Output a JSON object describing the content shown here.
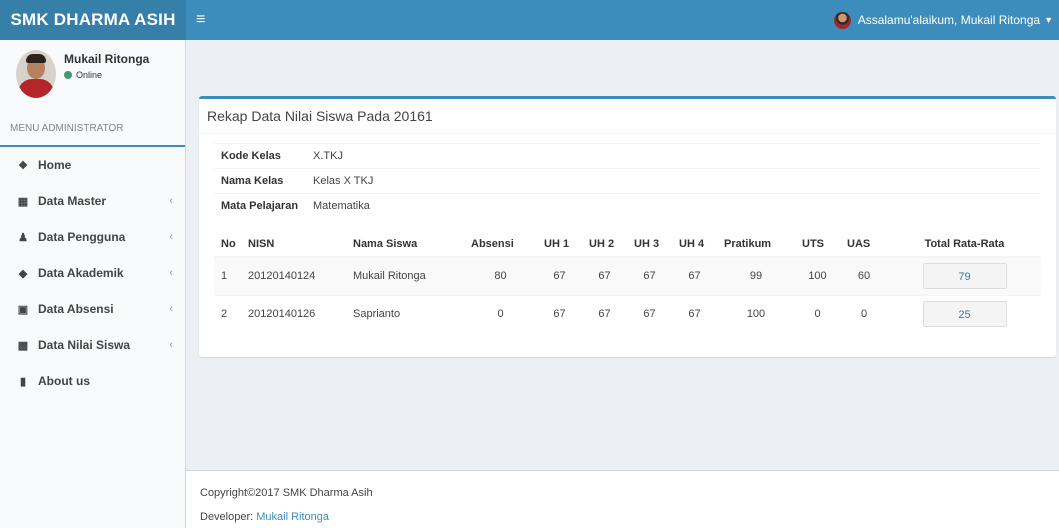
{
  "header": {
    "brand": "SMK DHARMA ASIH",
    "greeting": "Assalamu'alaikum, Mukail Ritonga"
  },
  "sidebar": {
    "user_name": "Mukail Ritonga",
    "status": "Online",
    "menu_header": "MENU ADMINISTRATOR",
    "items": [
      {
        "label": "Home",
        "icon": "home-icon"
      },
      {
        "label": "Data Master",
        "icon": "grid-icon"
      },
      {
        "label": "Data Pengguna",
        "icon": "user-icon"
      },
      {
        "label": "Data Akademik",
        "icon": "tag-icon"
      },
      {
        "label": "Data Absensi",
        "icon": "calendar-icon"
      },
      {
        "label": "Data Nilai Siswa",
        "icon": "th-large-icon"
      },
      {
        "label": "About us",
        "icon": "book-icon"
      }
    ]
  },
  "box": {
    "title": "Rekap Data Nilai Siswa Pada 20161",
    "info": [
      {
        "key": "Kode Kelas",
        "value": "X.TKJ"
      },
      {
        "key": "Nama Kelas",
        "value": "Kelas X TKJ"
      },
      {
        "key": "Mata Pelajaran",
        "value": "Matematika"
      }
    ]
  },
  "table": {
    "headers": [
      "No",
      "NISN",
      "Nama Siswa",
      "Absensi",
      "UH 1",
      "UH 2",
      "UH 3",
      "UH 4",
      "Pratikum",
      "UTS",
      "UAS",
      "Total Rata-Rata"
    ],
    "rows": [
      [
        "1",
        "20120140124",
        "Mukail Ritonga",
        "80",
        "67",
        "67",
        "67",
        "67",
        "99",
        "100",
        "60",
        "79"
      ],
      [
        "2",
        "20120140126",
        "Saprianto",
        "0",
        "67",
        "67",
        "67",
        "67",
        "100",
        "0",
        "0",
        "25"
      ]
    ]
  },
  "footer": {
    "copyright": "Copyright©2017 SMK Dharma Asih",
    "developer_label": "Developer: ",
    "developer_name": "Mukail Ritonga"
  },
  "colors": {
    "brand_dark": "#367fa9",
    "brand": "#3c8dbc",
    "online": "#3d9970"
  }
}
